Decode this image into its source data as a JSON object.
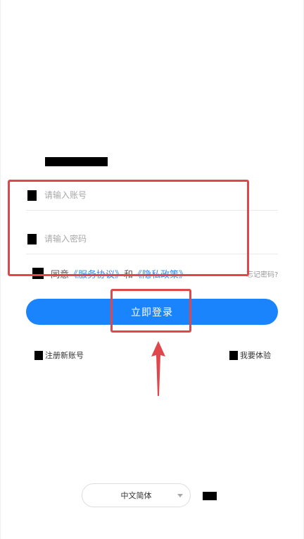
{
  "login": {
    "account_placeholder": "请输入账号",
    "password_placeholder": "请输入密码",
    "agree_prefix": "同意",
    "service_agreement": "《服务协议》",
    "agree_and": "和",
    "privacy_policy": "《隐私政策》",
    "forgot_password": "忘记密码?",
    "login_button": "立即登录",
    "register_link": "注册新账号",
    "trial_link": "我要体验",
    "language_selected": "中文简体"
  },
  "icons": {
    "logo": "logo-redacted",
    "account": "user-icon",
    "password": "lock-icon",
    "agree": "checkbox-icon",
    "register": "register-icon",
    "trial": "trial-icon",
    "language": "chevron-down-icon"
  },
  "colors": {
    "primary": "#1a84fd",
    "link": "#3b88e8",
    "annotation": "#e0474c"
  }
}
